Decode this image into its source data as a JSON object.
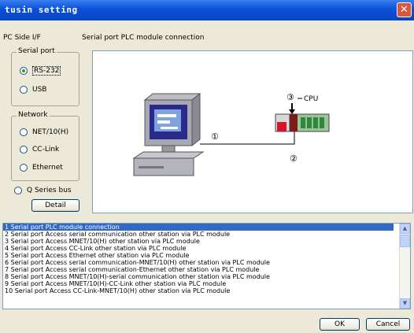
{
  "window": {
    "title": "tusin setting",
    "close_glyph": "✕"
  },
  "pc_side_label": "PC Side I/F",
  "diagram_caption": "Serial port PLC module connection",
  "serial_group": {
    "legend": "Serial port",
    "options": [
      "RS-232",
      "USB"
    ],
    "selected": "RS-232"
  },
  "network_group": {
    "legend": "Network",
    "options": [
      "NET/10(H)",
      "CC-Link",
      "Ethernet"
    ]
  },
  "q_series_bus": "Q Series bus",
  "detail_button": "Detail",
  "diagram": {
    "marker1": "①",
    "marker2": "②",
    "marker3": "③",
    "cpu_label": "CPU"
  },
  "connection_list": [
    "1 Serial port PLC module connection",
    "2 Serial port Access serial communication other station via PLC module",
    "3 Serial port Access MNET/10(H) other station via PLC module",
    "4 Serial port Access CC-Link other station via PLC module",
    "5 Serial port Access Ethernet other station via PLC module",
    "6 Serial port Access serial communication-MNET/10(H) other station via PLC module",
    "7 Serial port Access serial communication-Ethernet other station via PLC module",
    "8 Serial port Access MNET/10(H)-serial communication other station via PLC module",
    "9 Serial port Access MNET/10(H)-CC-Link other station via PLC module",
    "10 Serial port Access CC-Link-MNET/10(H) other station via PLC module"
  ],
  "selected_index": 0,
  "ok_button": "OK",
  "cancel_button": "Cancel",
  "icons": {
    "scroll_up": "scroll-up-icon",
    "scroll_down": "scroll-down-icon"
  }
}
